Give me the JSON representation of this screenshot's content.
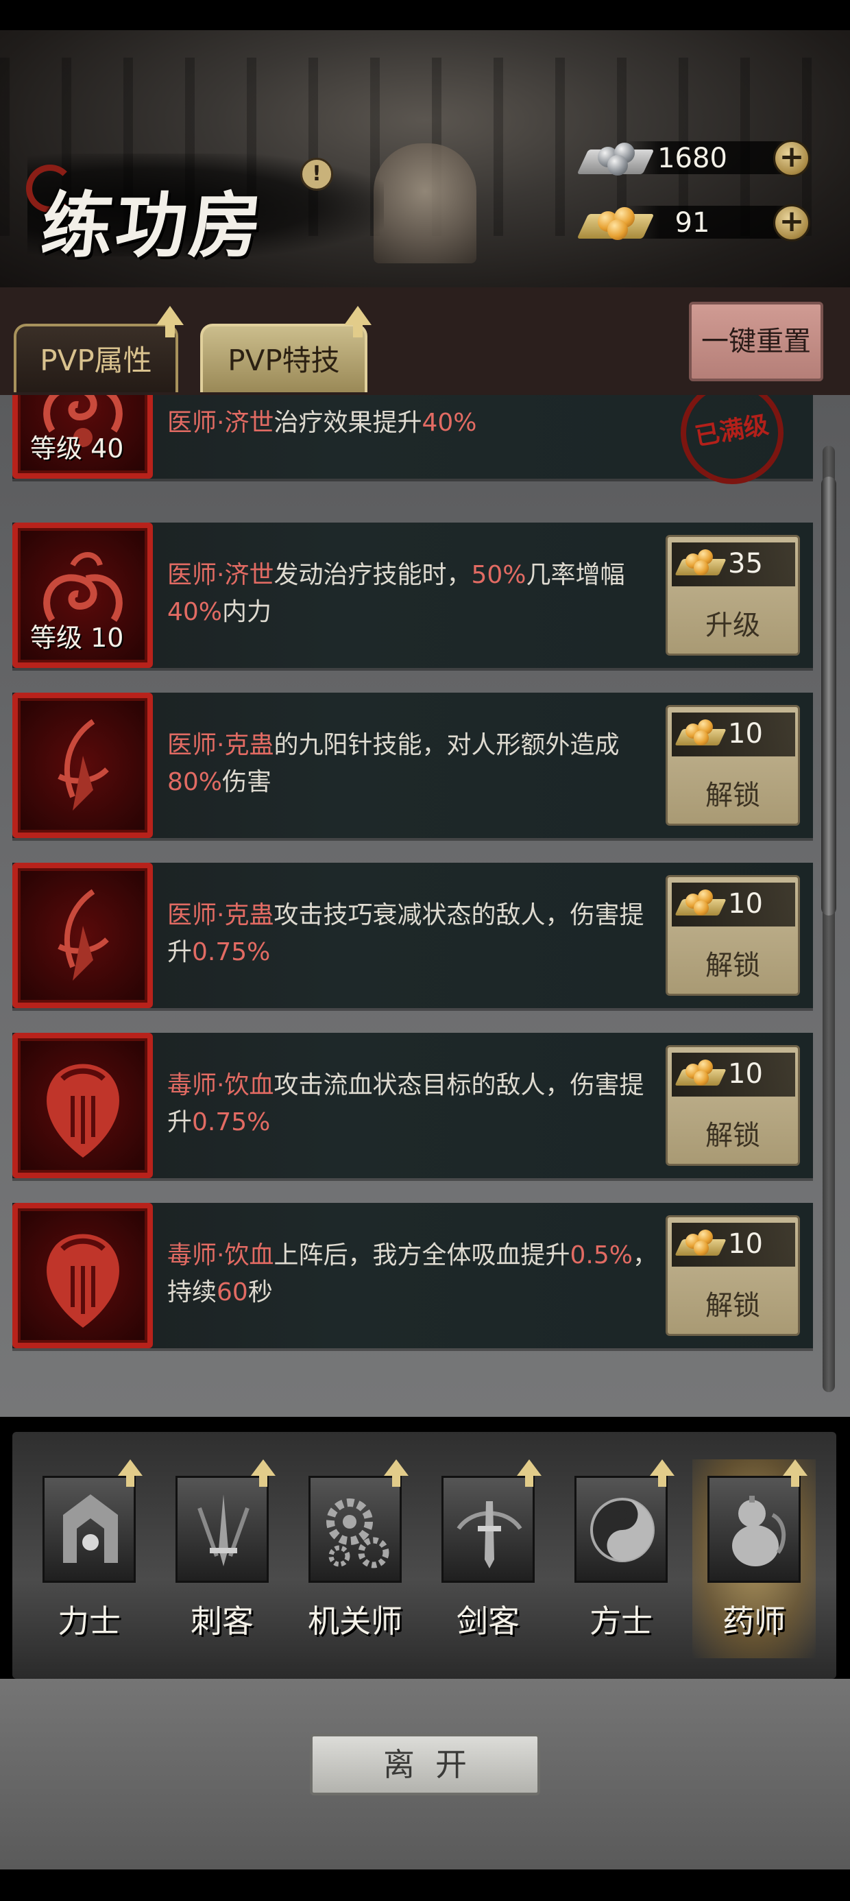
{
  "header": {
    "title": "练功房",
    "alert": "!",
    "currency": {
      "silver": "1680",
      "gold": "91"
    }
  },
  "tabs": [
    {
      "label": "PVP属性"
    },
    {
      "label": "PVP特技"
    }
  ],
  "reset_button": "一键重置",
  "skills": [
    {
      "level": "等级 40",
      "desc_hl1": "医师·济世",
      "desc_rest": "治疗效果提升",
      "desc_hl2": "40%",
      "status": "已满级"
    },
    {
      "level": "等级 10",
      "desc_hl1": "医师·济世",
      "desc_a": "发动治疗技能时，",
      "desc_hl2": "50%",
      "desc_b": "几率增幅",
      "desc_hl3": "40%",
      "desc_c": "内力",
      "cost": "35",
      "action": "升级"
    },
    {
      "desc_hl1": "医师·克蛊",
      "desc_a": "的九阳针技能，对人形额外造成",
      "desc_hl2": "80%",
      "desc_b": "伤害",
      "cost": "10",
      "action": "解锁"
    },
    {
      "desc_hl1": "医师·克蛊",
      "desc_a": "攻击技巧衰减状态的敌人，伤害提升",
      "desc_hl2": "0.75%",
      "cost": "10",
      "action": "解锁"
    },
    {
      "desc_hl1": "毒师·饮血",
      "desc_a": "攻击流血状态目标的敌人，伤害提升",
      "desc_hl2": "0.75%",
      "cost": "10",
      "action": "解锁"
    },
    {
      "desc_hl1": "毒师·饮血",
      "desc_a": "上阵后，我方全体吸血提升",
      "desc_hl2": "0.5%",
      "desc_b": "，持续",
      "desc_hl3": "60",
      "desc_c": "秒",
      "cost": "10",
      "action": "解锁"
    }
  ],
  "classes": [
    {
      "label": "力士",
      "icon": "helmet-icon"
    },
    {
      "label": "刺客",
      "icon": "blade-icon"
    },
    {
      "label": "机关师",
      "icon": "gears-icon"
    },
    {
      "label": "剑客",
      "icon": "sword-icon"
    },
    {
      "label": "方士",
      "icon": "yinyang-icon"
    },
    {
      "label": "药师",
      "icon": "gourd-icon",
      "selected": true
    }
  ],
  "leave_button": "离开",
  "colors": {
    "highlight": "#e26b63",
    "frame_red": "#b8221b",
    "gold": "#e2cc8a"
  }
}
